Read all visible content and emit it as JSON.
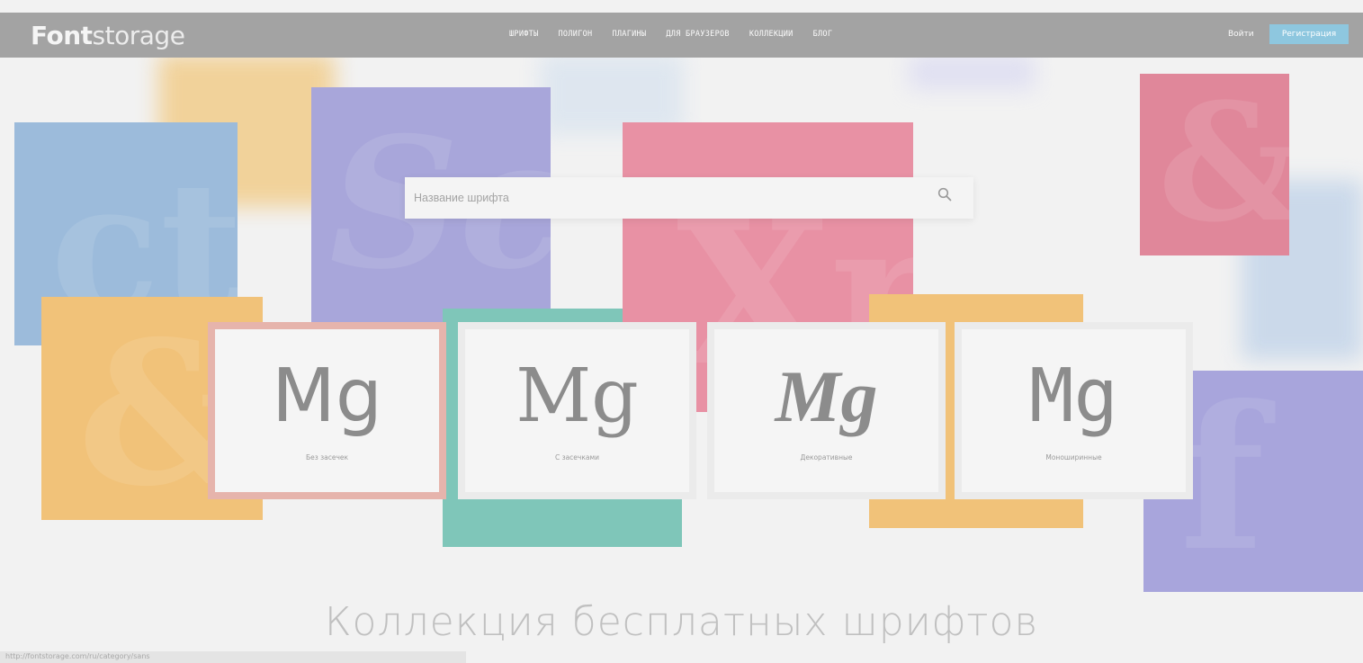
{
  "header": {
    "logo_part1": "Font",
    "logo_part2": "storage",
    "nav": [
      "шрифты",
      "полигон",
      "плагины",
      "для браузеров",
      "коллекции",
      "блог"
    ],
    "login_label": "Войти",
    "register_label": "Регистрация"
  },
  "search": {
    "placeholder": "Название шрифта",
    "icon": "search-icon"
  },
  "categories": [
    {
      "sample": "Mg",
      "label": "Без засечек",
      "border_color": "#e6b4ac"
    },
    {
      "sample": "Mg",
      "label": "С засечками",
      "border_color": "#ebebeb"
    },
    {
      "sample": "Mg",
      "label": "Декоративные",
      "border_color": "#ebebeb"
    },
    {
      "sample": "Mg",
      "label": "Моноширинные",
      "border_color": "#ebebeb"
    }
  ],
  "headline": "Коллекция бесплатных шрифтов",
  "status_url": "http://fontstorage.com/ru/category/sans",
  "colors": {
    "topbar": "#a3a3a3",
    "accent": "#8ec7df",
    "tile_blue": "#9bbcdc",
    "tile_purple": "#a9a6d9",
    "tile_pink": "#e8909f",
    "tile_orange": "#f0c07a",
    "tile_teal": "#86c7bc"
  }
}
